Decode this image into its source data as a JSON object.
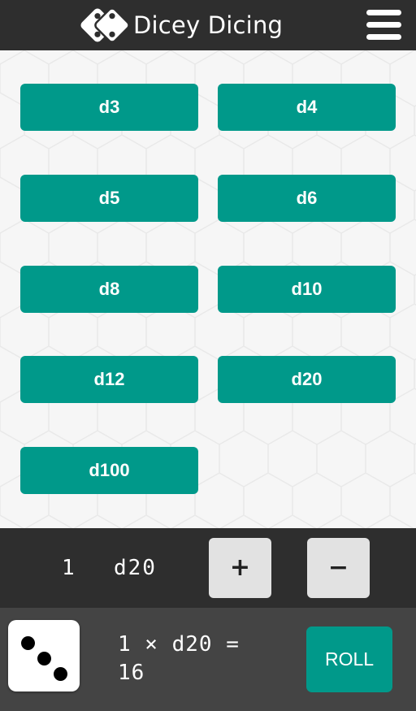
{
  "header": {
    "title": "Dicey Dicing",
    "logo_icon": "dice-pair-icon",
    "menu_icon": "hamburger-menu-icon",
    "background": "#2e2e2e"
  },
  "dice_buttons": [
    {
      "label": "d3"
    },
    {
      "label": "d4"
    },
    {
      "label": "d5"
    },
    {
      "label": "d6"
    },
    {
      "label": "d8"
    },
    {
      "label": "d10"
    },
    {
      "label": "d12"
    },
    {
      "label": "d20"
    },
    {
      "label": "d100"
    }
  ],
  "counter": {
    "quantity": "1",
    "die": "d20",
    "increment_label": "+",
    "decrement_label": "−"
  },
  "result": {
    "die_face_value": 3,
    "die_face_icon": "die-three-icon",
    "expression": "1 × d20 =",
    "total": "16",
    "roll_label": "ROLL"
  },
  "colors": {
    "accent": "#00998a",
    "dark_bar": "#2e2e2e",
    "result_bar": "#444444",
    "step_button": "#e2e2e2"
  }
}
